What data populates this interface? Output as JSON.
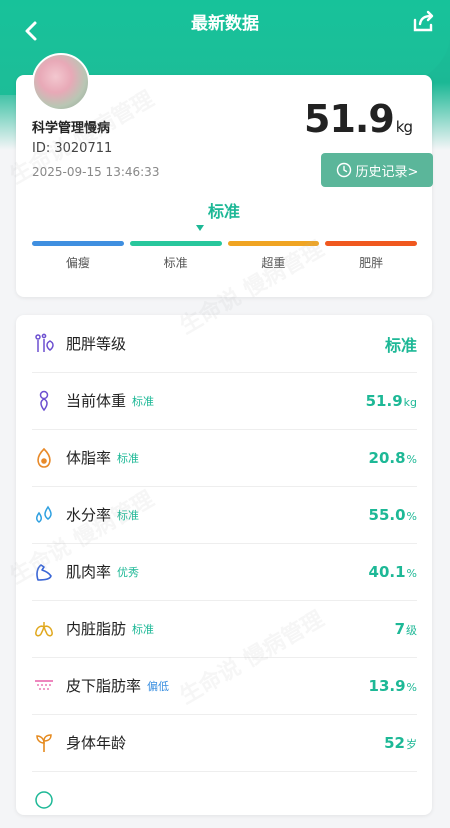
{
  "header": {
    "title": "最新数据"
  },
  "profile": {
    "name": "科学管理慢病",
    "id_text": "ID: 3020711",
    "time": "2025-09-15 13:46:33",
    "weight": "51.9",
    "weight_unit": "kg",
    "history_label": "历史记录>"
  },
  "status": {
    "current": "标准",
    "bars": [
      {
        "label": "偏瘦",
        "color": "#3f8fe0"
      },
      {
        "label": "标准",
        "color": "#28c79c"
      },
      {
        "label": "超重",
        "color": "#f0a422"
      },
      {
        "label": "肥胖",
        "color": "#f0581f"
      }
    ]
  },
  "metrics": [
    {
      "name": "肥胖等级",
      "tag": "",
      "value": "标准",
      "unit": "",
      "icon": "obesity-level-icon",
      "icon_color": "#6c4fd0"
    },
    {
      "name": "当前体重",
      "tag": "标准",
      "tag_color": "#1db896",
      "value": "51.9",
      "unit": "kg",
      "icon": "weight-icon",
      "icon_color": "#6c4fd0"
    },
    {
      "name": "体脂率",
      "tag": "标准",
      "tag_color": "#1db896",
      "value": "20.8",
      "unit": "%",
      "icon": "body-fat-icon",
      "icon_color": "#e88a2a"
    },
    {
      "name": "水分率",
      "tag": "标准",
      "tag_color": "#1db896",
      "value": "55.0",
      "unit": "%",
      "icon": "water-icon",
      "icon_color": "#2fa0e0"
    },
    {
      "name": "肌肉率",
      "tag": "优秀",
      "tag_color": "#1db896",
      "value": "40.1",
      "unit": "%",
      "icon": "muscle-icon",
      "icon_color": "#3a66d6"
    },
    {
      "name": "内脏脂肪",
      "tag": "标准",
      "tag_color": "#1db896",
      "value": "7",
      "unit": "级",
      "icon": "visceral-fat-icon",
      "icon_color": "#e0a81f"
    },
    {
      "name": "皮下脂肪率",
      "tag": "偏低",
      "tag_color": "#3a8fe0",
      "value": "13.9",
      "unit": "%",
      "icon": "subcutaneous-fat-icon",
      "icon_color": "#e85fa8"
    },
    {
      "name": "身体年龄",
      "tag": "",
      "value": "52",
      "unit": "岁",
      "icon": "sprout-icon",
      "icon_color": "#e58a1f"
    }
  ],
  "watermark": "生命说 慢病管理"
}
